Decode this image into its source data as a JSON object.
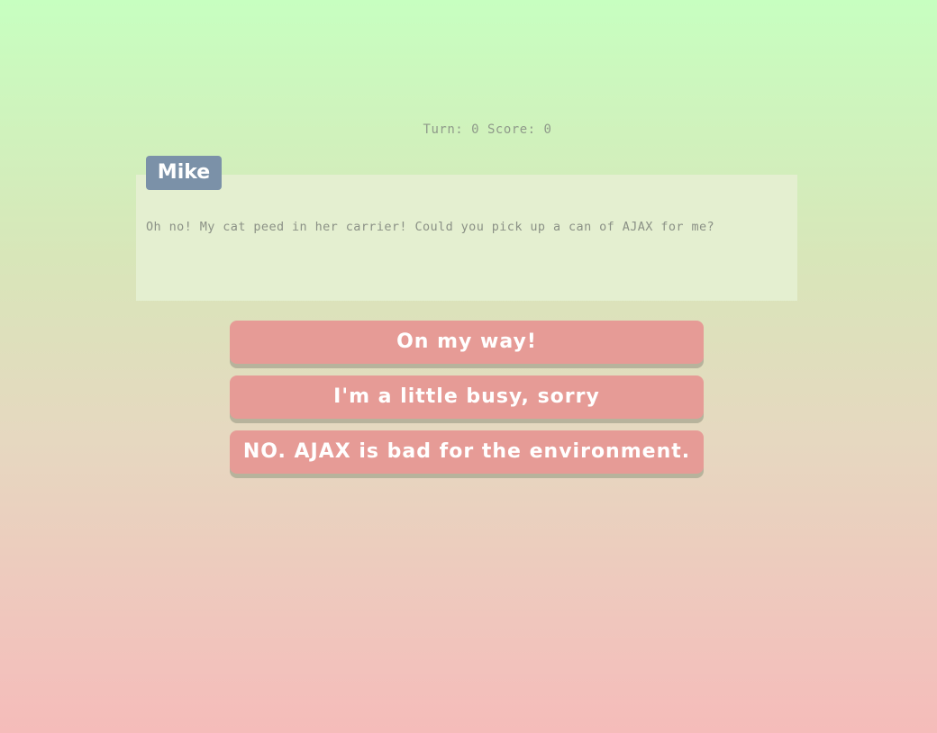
{
  "status": {
    "turn_text": "Turn: 0",
    "score_text": "Score: 0"
  },
  "dialog": {
    "speaker": "Mike",
    "message": "Oh no! My cat peed in her carrier! Could you pick up a can of AJAX for me?"
  },
  "choices": [
    {
      "label": "On my way!"
    },
    {
      "label": "I'm a little busy, sorry"
    },
    {
      "label": "NO. AJAX is bad for the environment."
    }
  ],
  "colors": {
    "speaker_tag": "#7b91a8",
    "dialog_bg": "#e4efd0",
    "choice_bg": "#e69b96",
    "choice_shadow": "#b7b39c",
    "gradient_top": "#c7ffc0",
    "gradient_bottom": "#f5bcba"
  }
}
